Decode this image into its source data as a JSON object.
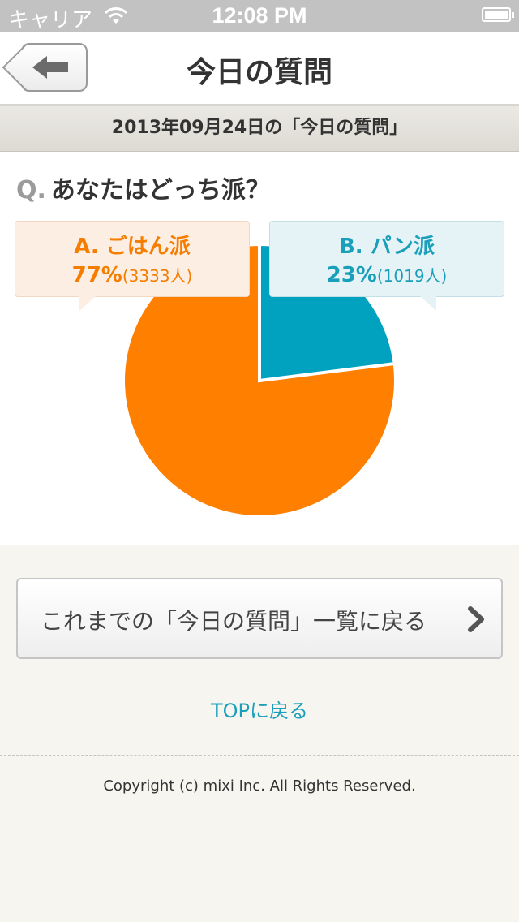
{
  "status": {
    "carrier": "キャリア",
    "time": "12:08 PM"
  },
  "nav": {
    "title": "今日の質問"
  },
  "date_header": "2013年09月24日の「今日の質問」",
  "question": {
    "prefix": "Q.",
    "text": "あなたはどっち派？"
  },
  "answers": [
    {
      "label": "A. ごはん派",
      "percent": "77%",
      "count": "(3333人)",
      "color": "#ff7f00"
    },
    {
      "label": "B. パン派",
      "percent": "23%",
      "count": "(1019人)",
      "color": "#00a2bf"
    }
  ],
  "chart_data": {
    "type": "pie",
    "categories": [
      "A. ごはん派",
      "B. パン派"
    ],
    "values": [
      77,
      23
    ],
    "counts": [
      3333,
      1019
    ],
    "colors": [
      "#ff7f00",
      "#00a2bf"
    ]
  },
  "actions": {
    "list_button": "これまでの「今日の質問」一覧に戻る",
    "top_link": "TOPに戻る"
  },
  "footer": {
    "copyright": "Copyright (c) mixi Inc. All Rights Reserved."
  }
}
